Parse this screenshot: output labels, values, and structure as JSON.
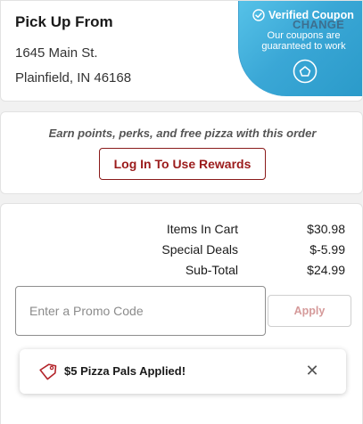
{
  "pickup": {
    "title": "Pick Up From",
    "address_line1": "1645 Main St.",
    "address_line2": "Plainfield, IN 46168",
    "change_label": "CHANGE"
  },
  "coupon_badge": {
    "title": "Verified Coupon",
    "line1": "Our coupons are",
    "line2": "guaranteed to work",
    "icon": "shield-check-icon",
    "color_start": "#56c2e8",
    "color_end": "#2a9ac9"
  },
  "rewards": {
    "text": "Earn points, perks, and free pizza with this order",
    "button_label": "Log In To Use Rewards",
    "accent": "#9b1b1b"
  },
  "summary": {
    "rows": [
      {
        "label": "Items In Cart",
        "value": "$30.98"
      },
      {
        "label": "Special Deals",
        "value": "$-5.99"
      },
      {
        "label": "Sub-Total",
        "value": "$24.99"
      }
    ]
  },
  "promo": {
    "placeholder": "Enter a Promo Code",
    "value": "",
    "apply_label": "Apply"
  },
  "toast": {
    "text": "$5 Pizza Pals Applied!",
    "icon": "tag-icon",
    "close_icon": "close-icon"
  }
}
